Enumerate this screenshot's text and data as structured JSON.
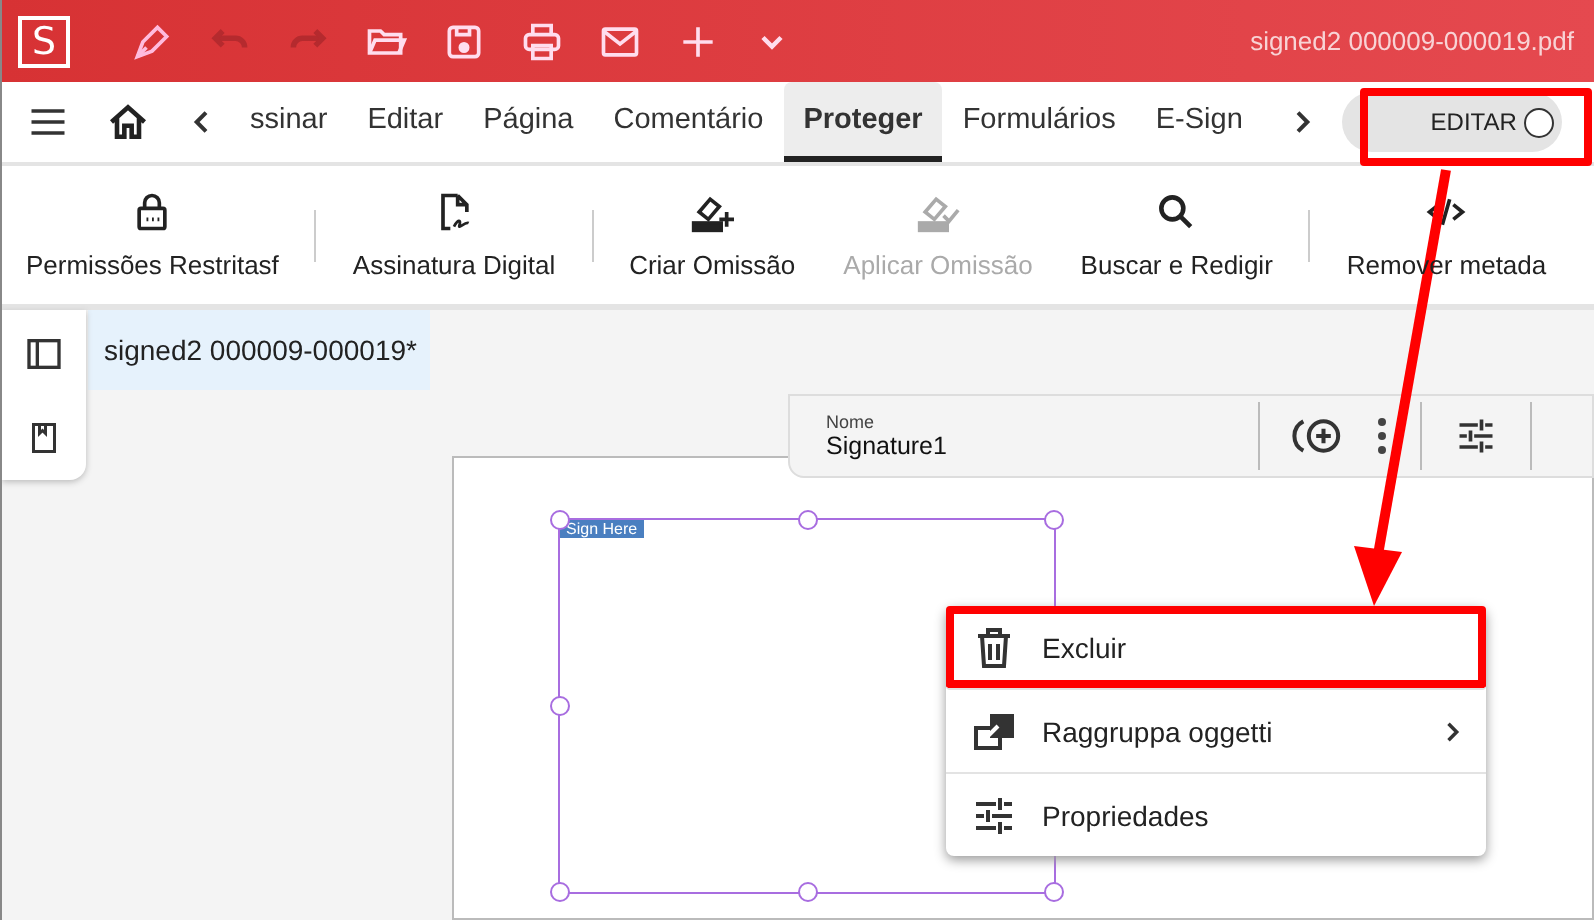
{
  "title_bar": {
    "logo": "S",
    "file_name": "signed2 000009-000019.pdf"
  },
  "tabs": [
    {
      "label": "ssinar",
      "selected": false
    },
    {
      "label": "Editar",
      "selected": false
    },
    {
      "label": "Página",
      "selected": false
    },
    {
      "label": "Comentário",
      "selected": false
    },
    {
      "label": "Proteger",
      "selected": true
    },
    {
      "label": "Formulários",
      "selected": false
    },
    {
      "label": "E-Sign",
      "selected": false
    }
  ],
  "edit_toggle": {
    "label": "EDITAR",
    "on": false
  },
  "ribbon": [
    {
      "label": "Permissões Restritasf",
      "disabled": false
    },
    {
      "label": "Assinatura Digital",
      "disabled": false
    },
    {
      "label": "Criar Omissão",
      "disabled": false
    },
    {
      "label": "Aplicar Omissão",
      "disabled": true
    },
    {
      "label": "Buscar e Redigir",
      "disabled": false
    },
    {
      "label": "Remover metada",
      "disabled": false
    }
  ],
  "document_tab": {
    "label": "signed2 000009-000019*",
    "selected": true
  },
  "field_toolbar": {
    "name_label": "Nome",
    "name_value": "Signature1"
  },
  "sign_field": {
    "label": "Sign Here"
  },
  "context_menu": [
    {
      "label": "Excluir",
      "submenu": false,
      "highlighted": true
    },
    {
      "label": "Raggruppa oggetti",
      "submenu": true,
      "highlighted": false
    },
    {
      "label": "Propriedades",
      "submenu": false,
      "highlighted": false
    }
  ]
}
